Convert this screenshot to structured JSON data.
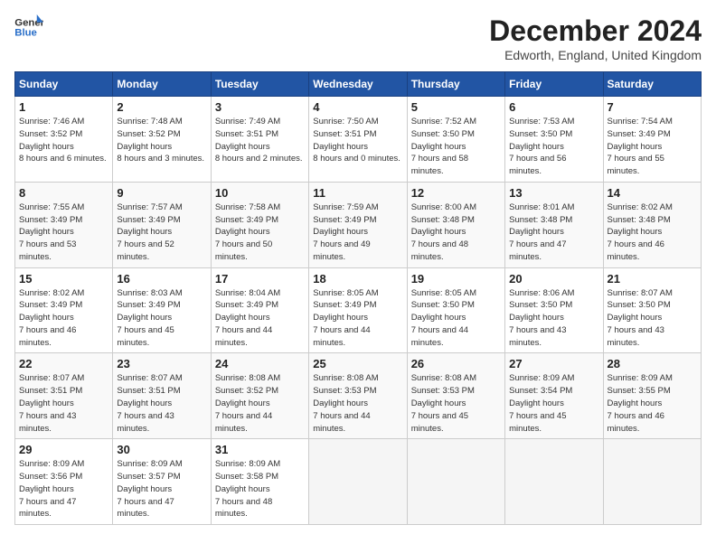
{
  "header": {
    "logo_line1": "General",
    "logo_line2": "Blue",
    "month": "December 2024",
    "location": "Edworth, England, United Kingdom"
  },
  "days_of_week": [
    "Sunday",
    "Monday",
    "Tuesday",
    "Wednesday",
    "Thursday",
    "Friday",
    "Saturday"
  ],
  "weeks": [
    [
      {
        "day": 1,
        "sunrise": "7:46 AM",
        "sunset": "3:52 PM",
        "daylight": "8 hours and 6 minutes."
      },
      {
        "day": 2,
        "sunrise": "7:48 AM",
        "sunset": "3:52 PM",
        "daylight": "8 hours and 3 minutes."
      },
      {
        "day": 3,
        "sunrise": "7:49 AM",
        "sunset": "3:51 PM",
        "daylight": "8 hours and 2 minutes."
      },
      {
        "day": 4,
        "sunrise": "7:50 AM",
        "sunset": "3:51 PM",
        "daylight": "8 hours and 0 minutes."
      },
      {
        "day": 5,
        "sunrise": "7:52 AM",
        "sunset": "3:50 PM",
        "daylight": "7 hours and 58 minutes."
      },
      {
        "day": 6,
        "sunrise": "7:53 AM",
        "sunset": "3:50 PM",
        "daylight": "7 hours and 56 minutes."
      },
      {
        "day": 7,
        "sunrise": "7:54 AM",
        "sunset": "3:49 PM",
        "daylight": "7 hours and 55 minutes."
      }
    ],
    [
      {
        "day": 8,
        "sunrise": "7:55 AM",
        "sunset": "3:49 PM",
        "daylight": "7 hours and 53 minutes."
      },
      {
        "day": 9,
        "sunrise": "7:57 AM",
        "sunset": "3:49 PM",
        "daylight": "7 hours and 52 minutes."
      },
      {
        "day": 10,
        "sunrise": "7:58 AM",
        "sunset": "3:49 PM",
        "daylight": "7 hours and 50 minutes."
      },
      {
        "day": 11,
        "sunrise": "7:59 AM",
        "sunset": "3:49 PM",
        "daylight": "7 hours and 49 minutes."
      },
      {
        "day": 12,
        "sunrise": "8:00 AM",
        "sunset": "3:48 PM",
        "daylight": "7 hours and 48 minutes."
      },
      {
        "day": 13,
        "sunrise": "8:01 AM",
        "sunset": "3:48 PM",
        "daylight": "7 hours and 47 minutes."
      },
      {
        "day": 14,
        "sunrise": "8:02 AM",
        "sunset": "3:48 PM",
        "daylight": "7 hours and 46 minutes."
      }
    ],
    [
      {
        "day": 15,
        "sunrise": "8:02 AM",
        "sunset": "3:49 PM",
        "daylight": "7 hours and 46 minutes."
      },
      {
        "day": 16,
        "sunrise": "8:03 AM",
        "sunset": "3:49 PM",
        "daylight": "7 hours and 45 minutes."
      },
      {
        "day": 17,
        "sunrise": "8:04 AM",
        "sunset": "3:49 PM",
        "daylight": "7 hours and 44 minutes."
      },
      {
        "day": 18,
        "sunrise": "8:05 AM",
        "sunset": "3:49 PM",
        "daylight": "7 hours and 44 minutes."
      },
      {
        "day": 19,
        "sunrise": "8:05 AM",
        "sunset": "3:50 PM",
        "daylight": "7 hours and 44 minutes."
      },
      {
        "day": 20,
        "sunrise": "8:06 AM",
        "sunset": "3:50 PM",
        "daylight": "7 hours and 43 minutes."
      },
      {
        "day": 21,
        "sunrise": "8:07 AM",
        "sunset": "3:50 PM",
        "daylight": "7 hours and 43 minutes."
      }
    ],
    [
      {
        "day": 22,
        "sunrise": "8:07 AM",
        "sunset": "3:51 PM",
        "daylight": "7 hours and 43 minutes."
      },
      {
        "day": 23,
        "sunrise": "8:07 AM",
        "sunset": "3:51 PM",
        "daylight": "7 hours and 43 minutes."
      },
      {
        "day": 24,
        "sunrise": "8:08 AM",
        "sunset": "3:52 PM",
        "daylight": "7 hours and 44 minutes."
      },
      {
        "day": 25,
        "sunrise": "8:08 AM",
        "sunset": "3:53 PM",
        "daylight": "7 hours and 44 minutes."
      },
      {
        "day": 26,
        "sunrise": "8:08 AM",
        "sunset": "3:53 PM",
        "daylight": "7 hours and 45 minutes."
      },
      {
        "day": 27,
        "sunrise": "8:09 AM",
        "sunset": "3:54 PM",
        "daylight": "7 hours and 45 minutes."
      },
      {
        "day": 28,
        "sunrise": "8:09 AM",
        "sunset": "3:55 PM",
        "daylight": "7 hours and 46 minutes."
      }
    ],
    [
      {
        "day": 29,
        "sunrise": "8:09 AM",
        "sunset": "3:56 PM",
        "daylight": "7 hours and 47 minutes."
      },
      {
        "day": 30,
        "sunrise": "8:09 AM",
        "sunset": "3:57 PM",
        "daylight": "7 hours and 47 minutes."
      },
      {
        "day": 31,
        "sunrise": "8:09 AM",
        "sunset": "3:58 PM",
        "daylight": "7 hours and 48 minutes."
      },
      null,
      null,
      null,
      null
    ]
  ]
}
